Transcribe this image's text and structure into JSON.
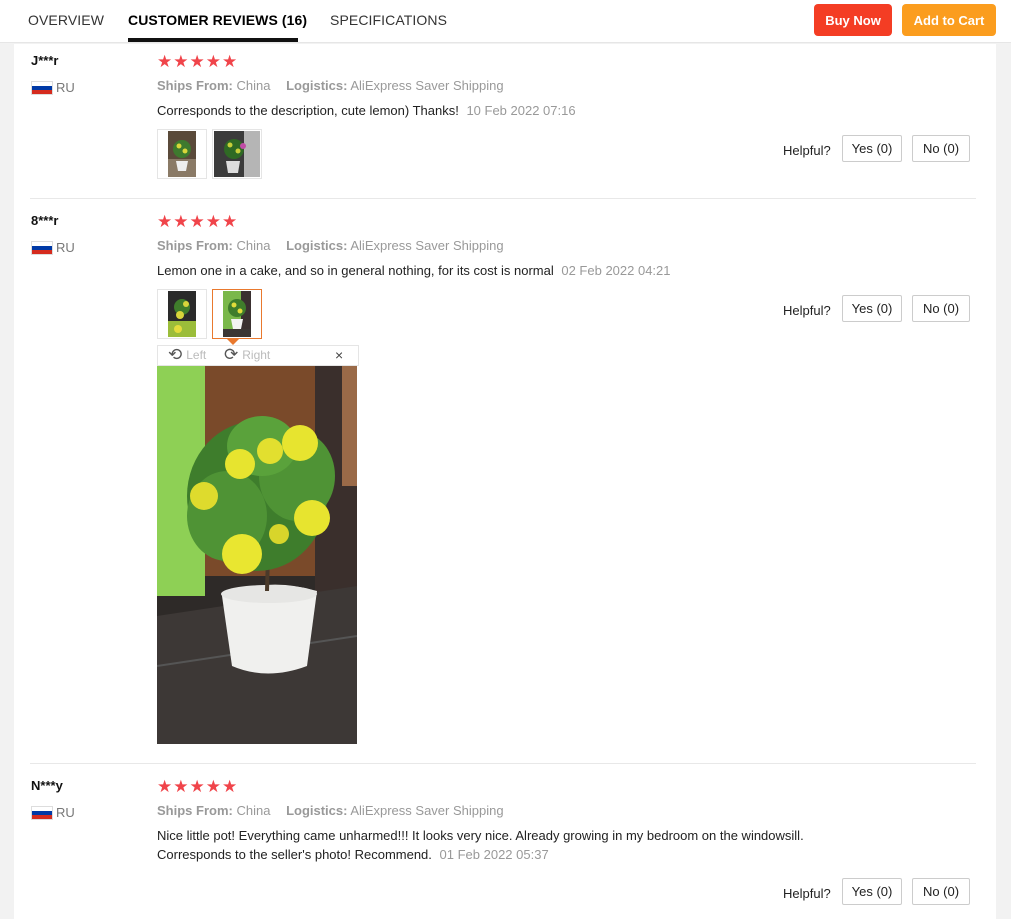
{
  "tabs": [
    {
      "label": "OVERVIEW"
    },
    {
      "label": "CUSTOMER REVIEWS (16)"
    },
    {
      "label": "SPECIFICATIONS"
    }
  ],
  "actions": {
    "buy_now": "Buy Now",
    "add_to_cart": "Add to Cart"
  },
  "labels": {
    "ships_from": "Ships From:",
    "logistics": "Logistics:",
    "helpful": "Helpful?",
    "stars": "★★★★★"
  },
  "reviews": [
    {
      "user": "J***r",
      "country": "RU",
      "rating": 5,
      "ships_from": "China",
      "logistics": "AliExpress Saver Shipping",
      "text": "Corresponds to the description, cute lemon) Thanks!",
      "date": "10 Feb 2022 07:16",
      "yes": "Yes (0)",
      "no": "No (0)"
    },
    {
      "user": "8***r",
      "country": "RU",
      "rating": 5,
      "ships_from": "China",
      "logistics": "AliExpress Saver Shipping",
      "text": "Lemon one in a cake, and so in general nothing, for its cost is normal",
      "date": "02 Feb 2022 04:21",
      "yes": "Yes (0)",
      "no": "No (0)"
    },
    {
      "user": "N***y",
      "country": "RU",
      "rating": 5,
      "ships_from": "China",
      "logistics": "AliExpress Saver Shipping",
      "text_line1": "Nice little pot! Everything came unharmed!!! It looks very nice. Already growing in my bedroom on the windowsill.",
      "text_line2": "Corresponds to the seller's photo! Recommend.",
      "date": "01 Feb 2022 05:37",
      "yes": "Yes (0)",
      "no": "No (0)"
    }
  ],
  "viewer": {
    "rotate_left": "Left",
    "rotate_right": "Right",
    "close": "×"
  },
  "colors": {
    "buy_now": "#f43d24",
    "add_to_cart": "#fb9d1e",
    "stars": "#f0444a",
    "selected_thumb": "#e9792e"
  }
}
